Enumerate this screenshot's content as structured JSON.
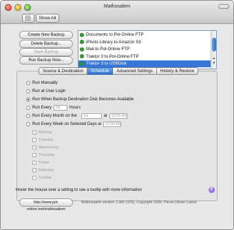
{
  "window": {
    "title": "Mathusalem"
  },
  "toolbar": {
    "show_all_label": "Show All"
  },
  "actions": {
    "create": "Create New Backup",
    "delete": "Delete Backup...",
    "save": "Save Backup",
    "run_now": "Run Backup Now..."
  },
  "backups": [
    {
      "name": "Documents to Pol-Online FTP",
      "selected": false
    },
    {
      "name": "iPhoto Library to Amazon S3",
      "selected": false
    },
    {
      "name": "Mail to Pol-Online FTP",
      "selected": false
    },
    {
      "name": "Traktor 3 to Pol-Online FTP",
      "selected": false
    },
    {
      "name": "Traktor 3 to USBDisk",
      "selected": true
    }
  ],
  "tabs": [
    {
      "label": "Source & Destination",
      "active": false
    },
    {
      "label": "Schedule",
      "active": true
    },
    {
      "label": "Advanced Settings",
      "active": false
    },
    {
      "label": "History & Restore",
      "active": false
    }
  ],
  "schedule": {
    "manually": "Run Manually",
    "login": "Run at User Login",
    "disk_available": "Run When Backup Destination Disk Becomes Available",
    "every_prefix": "Run Every",
    "every_value": "24",
    "every_unit": "Hours",
    "month_prefix": "Run Every Month on the",
    "month_day": "1st",
    "at_label": "at",
    "month_time": "12:00 AM",
    "week_prefix": "Run Every Week on Selected Days at",
    "week_time": "12:00 AM",
    "days": [
      "Monday",
      "Tuesday",
      "Wednesday",
      "Thursday",
      "Friday",
      "Saturday",
      "Sunday"
    ]
  },
  "hint": "Hover the mouse over a setting to see a tooltip with more information",
  "help_label": "?",
  "footer": {
    "url": "http://www.pol-online.net/mathusalem",
    "version": "Mathusalem version 1.0b5 (325), Copyright 2008, Pierre-Olivier Latour"
  },
  "colors": {
    "selection": "#3776d6",
    "status_ok": "#2da832",
    "tab_active": "#2f6fd0"
  }
}
